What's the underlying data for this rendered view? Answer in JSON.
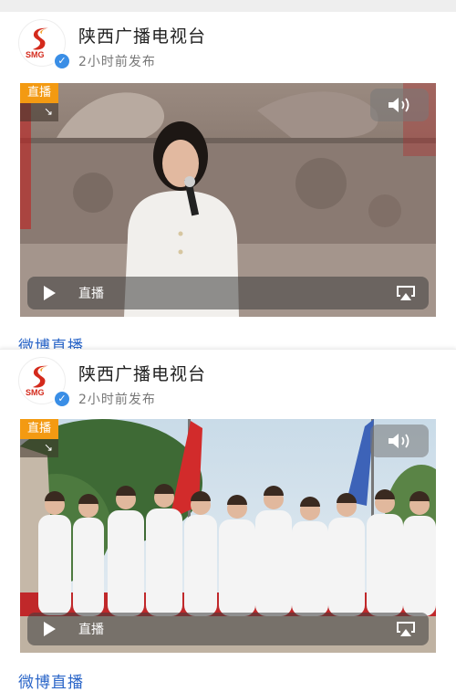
{
  "account": {
    "name": "陕西广播电视台",
    "avatar_abbr": "SMG",
    "posted_time": "2小时前发布"
  },
  "posts": [
    {
      "live_badge": "直播",
      "control_label": "直播",
      "footer_link": "微博直播"
    },
    {
      "live_badge": "直播",
      "control_label": "直播",
      "footer_link": "微博直播"
    }
  ],
  "colors": {
    "live_badge": "#f39a12",
    "link": "#2b66c8",
    "verify": "#3a8ee6",
    "logo_red": "#d42a1c",
    "logo_orange": "#f29a1e"
  },
  "icons": [
    "verified-icon",
    "volume-icon",
    "play-icon",
    "airplay-icon",
    "expand-arrow-icon"
  ]
}
